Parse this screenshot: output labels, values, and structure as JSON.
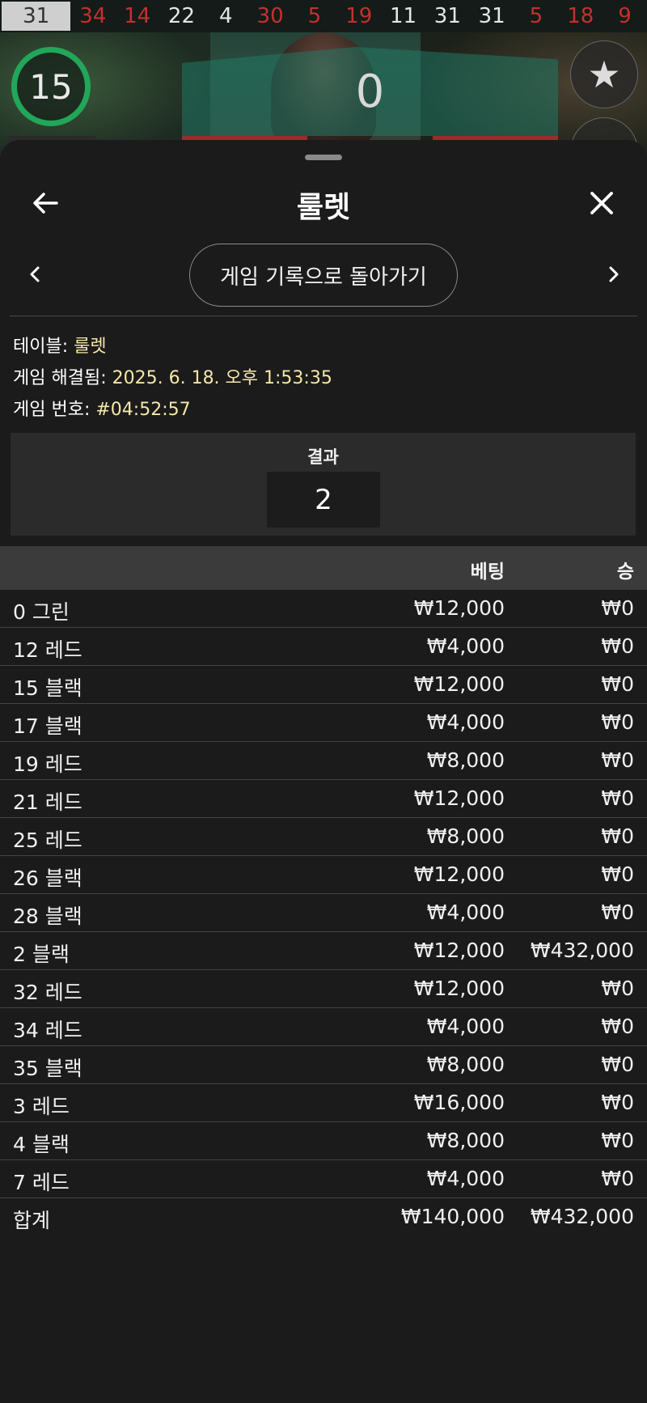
{
  "history_numbers": [
    {
      "value": "31",
      "color": "first"
    },
    {
      "value": "34",
      "color": "red"
    },
    {
      "value": "14",
      "color": "red"
    },
    {
      "value": "22",
      "color": "black"
    },
    {
      "value": "4",
      "color": "black"
    },
    {
      "value": "30",
      "color": "red"
    },
    {
      "value": "5",
      "color": "red"
    },
    {
      "value": "19",
      "color": "red"
    },
    {
      "value": "11",
      "color": "black"
    },
    {
      "value": "31",
      "color": "black"
    },
    {
      "value": "31",
      "color": "black"
    },
    {
      "value": "5",
      "color": "red"
    },
    {
      "value": "18",
      "color": "red"
    },
    {
      "value": "9",
      "color": "red"
    }
  ],
  "game": {
    "timer": "15",
    "last_result": "0"
  },
  "sheet": {
    "title": "룰렛",
    "back_to_history": "게임 기록으로 돌아가기"
  },
  "info": {
    "table_label": "테이블: ",
    "table_value": "룰렛",
    "resolved_label": "게임 해결됨: ",
    "resolved_value": "2025. 6. 18. 오후 1:53:35",
    "number_label": "게임 번호: ",
    "number_value": "#04:52:57"
  },
  "result": {
    "label": "결과",
    "value": "2"
  },
  "bets_table": {
    "col_bet": "베팅",
    "col_win": "승",
    "rows": [
      {
        "name": "0 그린",
        "bet": "₩12,000",
        "win": "₩0"
      },
      {
        "name": "12 레드",
        "bet": "₩4,000",
        "win": "₩0"
      },
      {
        "name": "15 블랙",
        "bet": "₩12,000",
        "win": "₩0"
      },
      {
        "name": "17 블랙",
        "bet": "₩4,000",
        "win": "₩0"
      },
      {
        "name": "19 레드",
        "bet": "₩8,000",
        "win": "₩0"
      },
      {
        "name": "21 레드",
        "bet": "₩12,000",
        "win": "₩0"
      },
      {
        "name": "25 레드",
        "bet": "₩8,000",
        "win": "₩0"
      },
      {
        "name": "26 블랙",
        "bet": "₩12,000",
        "win": "₩0"
      },
      {
        "name": "28 블랙",
        "bet": "₩4,000",
        "win": "₩0"
      },
      {
        "name": "2 블랙",
        "bet": "₩12,000",
        "win": "₩432,000"
      },
      {
        "name": "32 레드",
        "bet": "₩12,000",
        "win": "₩0"
      },
      {
        "name": "34 레드",
        "bet": "₩4,000",
        "win": "₩0"
      },
      {
        "name": "35 블랙",
        "bet": "₩8,000",
        "win": "₩0"
      },
      {
        "name": "3 레드",
        "bet": "₩16,000",
        "win": "₩0"
      },
      {
        "name": "4 블랙",
        "bet": "₩8,000",
        "win": "₩0"
      },
      {
        "name": "7 레드",
        "bet": "₩4,000",
        "win": "₩0"
      }
    ],
    "total": {
      "name": "합계",
      "bet": "₩140,000",
      "win": "₩432,000"
    }
  },
  "colors": {
    "accent_green": "#22a65a",
    "red_number": "#c2312f",
    "info_value": "#f5e7a8"
  }
}
